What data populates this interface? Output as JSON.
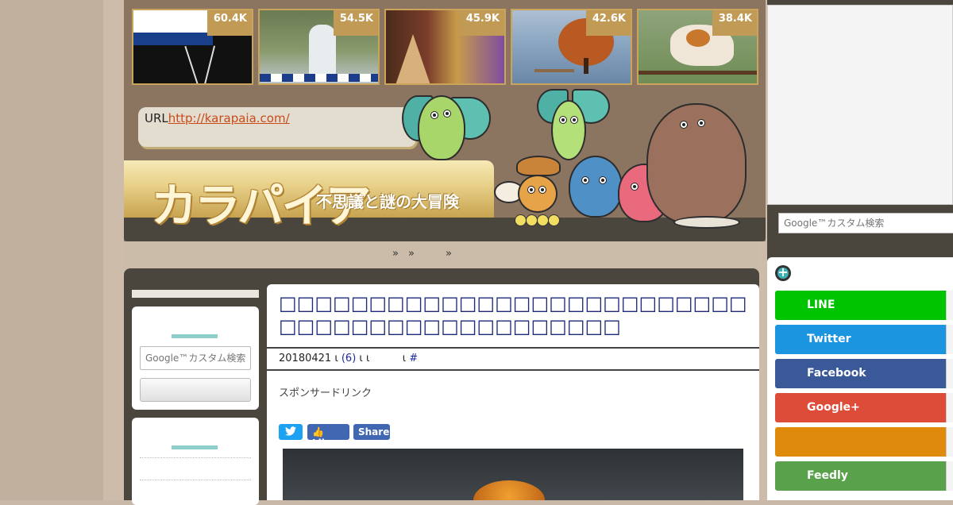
{
  "thumbnails": [
    {
      "count": "60.4K"
    },
    {
      "count": "54.5K"
    },
    {
      "count": "45.9K"
    },
    {
      "count": "42.6K"
    },
    {
      "count": "38.4K"
    }
  ],
  "header": {
    "url_label": "URL",
    "url_link": "http://karapaia.com/",
    "logo_text": "カラパイア",
    "logo_subtitle": "不思議と謎の大冒険"
  },
  "nav": {
    "separators": [
      "»",
      "»",
      "»"
    ]
  },
  "sidebar_left": {
    "search_placeholder": "Google™カスタム検索"
  },
  "article": {
    "title": "□□□□□□□□□□□□□□□□□□□□□□□□□□□□□□□□□□□□□□□□□□□□□",
    "meta": {
      "date": "20180421",
      "sep1": "ι",
      "comments": "(6)",
      "sep2": "ι",
      "sep3": "ι",
      "sep4": "ι",
      "hash": "#"
    },
    "sponsored_label": "スポンサードリンク",
    "share": {
      "twitter_icon": "bird-icon",
      "like_label": "Like",
      "share_label": "Share"
    }
  },
  "sidebar_right": {
    "search_placeholder": "Google™カスタム検索",
    "follow_icon": "+",
    "buttons": [
      {
        "label": "LINE",
        "color": "#00c300"
      },
      {
        "label": "Twitter",
        "color": "#1b95e0"
      },
      {
        "label": "Facebook",
        "color": "#3b5998"
      },
      {
        "label": "Google+",
        "color": "#dd4b39"
      },
      {
        "label": "",
        "color": "#e08a0b"
      },
      {
        "label": "Feedly",
        "color": "#5aa14c"
      }
    ]
  },
  "colors": {
    "header_bg": "#8b7560",
    "dark_panel": "#4a463e",
    "accent_gold": "#c19a56",
    "link_orange": "#c94a1a",
    "title_blue": "#1d2a7a"
  }
}
